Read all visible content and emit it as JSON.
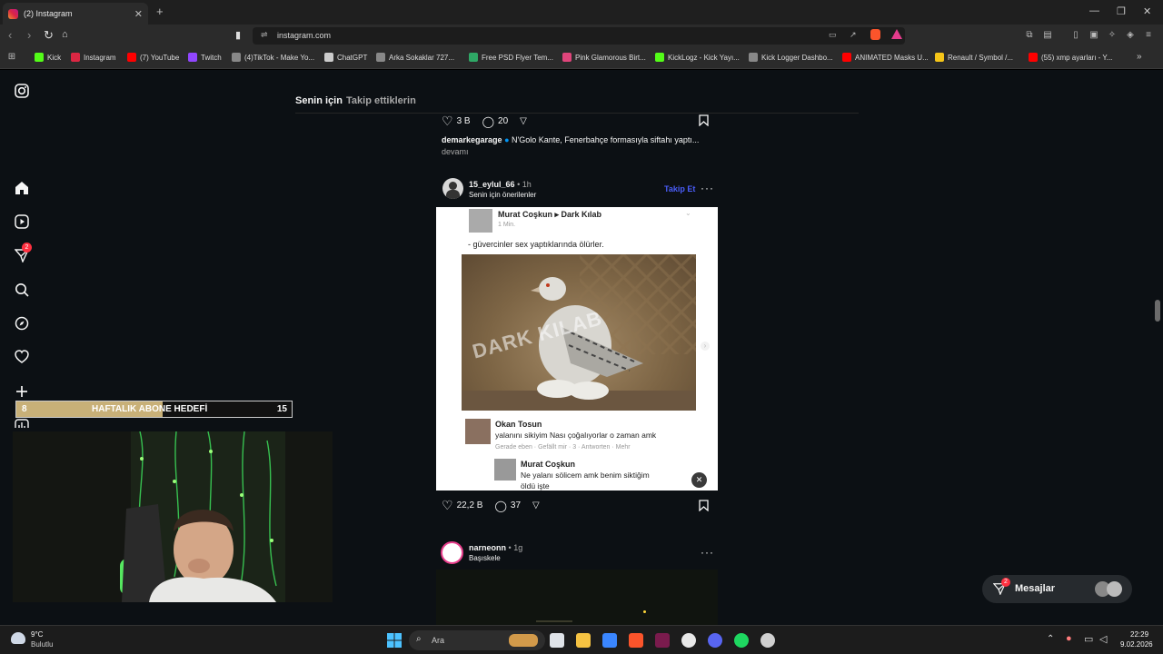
{
  "browser": {
    "tab_title": "(2) Instagram",
    "url": "instagram.com",
    "bookmarks": [
      {
        "label": "Kick",
        "color": "#53fc18"
      },
      {
        "label": "Instagram",
        "color": "#dc2743"
      },
      {
        "label": "(7) YouTube",
        "color": "#ff0000"
      },
      {
        "label": "Twitch",
        "color": "#9146ff"
      },
      {
        "label": "(4)TikTok - Make Yo...",
        "color": "#888888"
      },
      {
        "label": "ChatGPT",
        "color": "#cccccc"
      },
      {
        "label": "Arka Sokaklar 727...",
        "color": "#888888"
      },
      {
        "label": "Free PSD Flyer Tem...",
        "color": "#2fa866"
      },
      {
        "label": "Pink Glamorous Birt...",
        "color": "#e0457b"
      },
      {
        "label": "KickLogz - Kick Yayı...",
        "color": "#53fc18"
      },
      {
        "label": "Kick Logger Dashbo...",
        "color": "#888888"
      },
      {
        "label": "ANIMATED Masks U...",
        "color": "#ff0000"
      },
      {
        "label": "Renault / Symbol /...",
        "color": "#f5c518"
      },
      {
        "label": "(55) xmp ayarları - Y...",
        "color": "#ff0000"
      }
    ]
  },
  "instagram": {
    "tab_for_you": "Senin için",
    "tab_following": "Takip ettiklerin",
    "notification_count": "2",
    "prev_post": {
      "likes": "3 B",
      "comments": "20",
      "username": "demarkegarage",
      "caption": "N'Golo Kante, Fenerbahçe formasıyla siftahı yaptı...",
      "more": "devamı"
    },
    "post": {
      "username": "15_eylul_66",
      "time": "1h",
      "subtitle": "Senin için önerilenler",
      "follow": "Takip Et",
      "likes": "22,2 B",
      "comments": "37",
      "image": {
        "header_name": "Murat Coşkun ▸ Dark Kılab",
        "header_time": "1 Min.",
        "status_text": "- güvercinler sex yaptıklarında ölürler.",
        "watermark": "DARK KILAB",
        "comment1_name": "Okan Tosun",
        "comment1_text": "yalanını sikiyim Nası çoğalıyorlar o zaman amk",
        "comment1_meta": "Gerade eben · Gefällt mir · 3 · Antworten · Mehr",
        "comment2_name": "Murat Coşkun",
        "comment2_text": "Ne yalanı sölicem amk benim siktiğim ",
        "comment2_text2": "öldü işte"
      }
    },
    "next_post": {
      "username": "narneonn",
      "time": "1g",
      "subtitle": "Başıskele"
    },
    "messages_label": "Mesajlar",
    "messages_count": "2"
  },
  "overlay": {
    "goal_label": "HAFTALIK ABONE HEDEFİ",
    "goal_current": "8",
    "goal_target": "15",
    "goal_progress": 0.53
  },
  "taskbar": {
    "weather_temp": "9°C",
    "weather_desc": "Bulutlu",
    "search": "Ara",
    "time": "22:29",
    "date": "9.02.2026"
  }
}
